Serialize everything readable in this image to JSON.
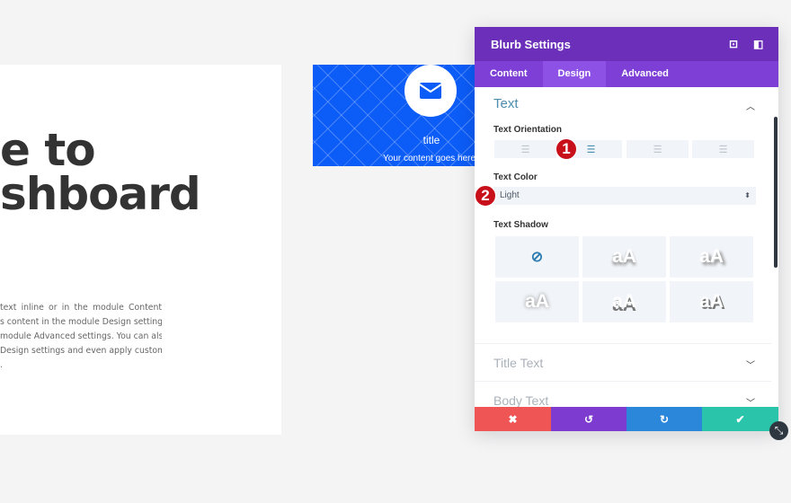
{
  "page": {
    "heading_line1": "e to",
    "heading_line2": "shboard",
    "paragraph": [
      "text inline or in the module Content",
      "s content in the module Design settings",
      "module Advanced settings. You can also",
      "Design settings and even apply custom",
      "."
    ]
  },
  "blurb": {
    "icon": "envelope-icon",
    "title": "title",
    "content": "Your content goes here",
    "background": "#0c5cf7"
  },
  "panel": {
    "title": "Blurb Settings",
    "tabs": [
      {
        "label": "Content"
      },
      {
        "label": "Design",
        "active": true
      },
      {
        "label": "Advanced"
      }
    ],
    "section_text": "Text",
    "text_orientation_label": "Text Orientation",
    "orientation_options": [
      "left",
      "center",
      "right",
      "justified"
    ],
    "orientation_selected": "center",
    "text_color_label": "Text Color",
    "text_color_value": "Light",
    "text_shadow_label": "Text Shadow",
    "shadow_preview": "aA",
    "section_title_text": "Title Text",
    "section_body_text": "Body Text",
    "colors": {
      "header": "#6b2fba",
      "tabs": "#7d3fd5",
      "cancel": "#ef5555",
      "undo": "#7e3bd0",
      "redo": "#2b87da",
      "save": "#29c4a9"
    }
  },
  "annotations": {
    "badge1": "1",
    "badge2": "2"
  }
}
